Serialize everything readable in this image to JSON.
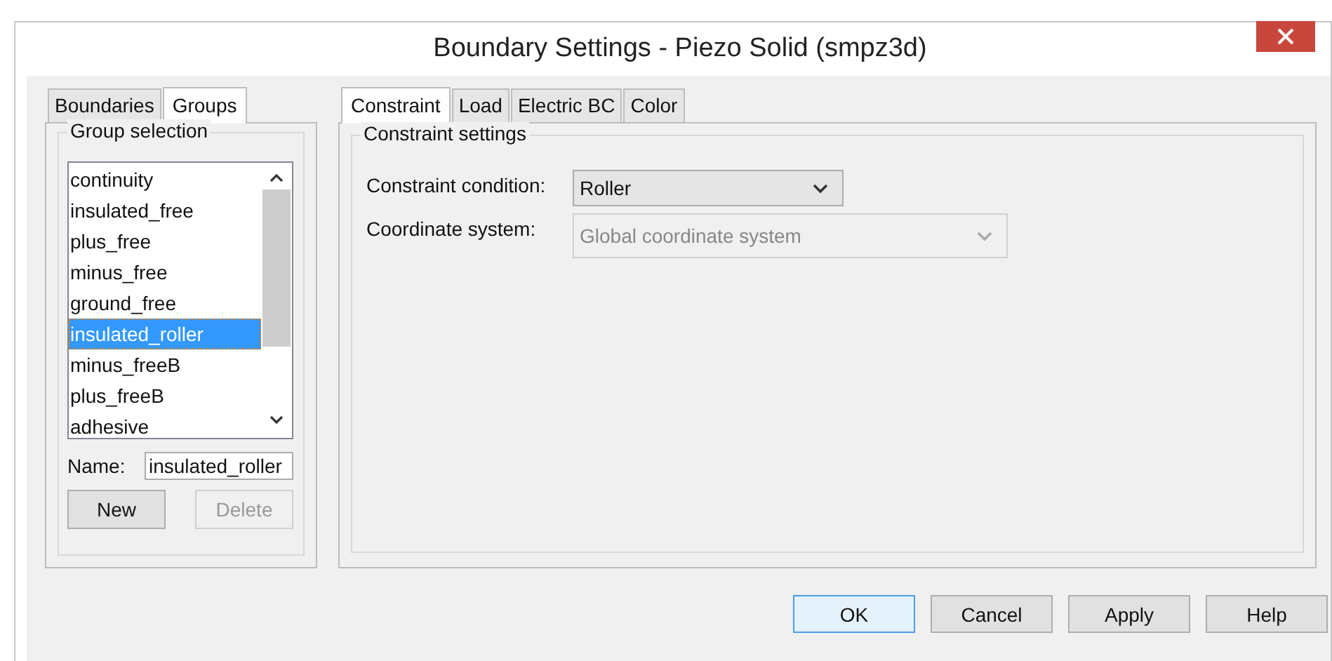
{
  "window": {
    "title": "Boundary Settings - Piezo Solid (smpz3d)"
  },
  "left_tabs": [
    {
      "label": "Boundaries",
      "selected": false
    },
    {
      "label": "Groups",
      "selected": true
    }
  ],
  "group_selection": {
    "title": "Group selection",
    "items": [
      {
        "label": "continuity",
        "selected": false
      },
      {
        "label": "insulated_free",
        "selected": false
      },
      {
        "label": "plus_free",
        "selected": false
      },
      {
        "label": "minus_free",
        "selected": false
      },
      {
        "label": "ground_free",
        "selected": false
      },
      {
        "label": "insulated_roller",
        "selected": true
      },
      {
        "label": "minus_freeB",
        "selected": false
      },
      {
        "label": "plus_freeB",
        "selected": false
      },
      {
        "label": "adhesive",
        "selected": false
      }
    ],
    "name_label": "Name:",
    "name_value": "insulated_roller",
    "buttons": [
      {
        "label": "New",
        "disabled": false
      },
      {
        "label": "Delete",
        "disabled": true
      }
    ]
  },
  "right_tabs": [
    {
      "label": "Constraint",
      "selected": true
    },
    {
      "label": "Load",
      "selected": false
    },
    {
      "label": "Electric BC",
      "selected": false
    },
    {
      "label": "Color",
      "selected": false
    }
  ],
  "constraint_settings": {
    "title": "Constraint settings",
    "fields": [
      {
        "label": "Constraint condition:",
        "value": "Roller",
        "disabled": false
      },
      {
        "label": "Coordinate system:",
        "value": "Global coordinate system",
        "disabled": true
      }
    ]
  },
  "buttons": [
    {
      "label": "OK",
      "default": true
    },
    {
      "label": "Cancel",
      "default": false
    },
    {
      "label": "Apply",
      "default": false
    },
    {
      "label": "Help",
      "default": false
    }
  ]
}
